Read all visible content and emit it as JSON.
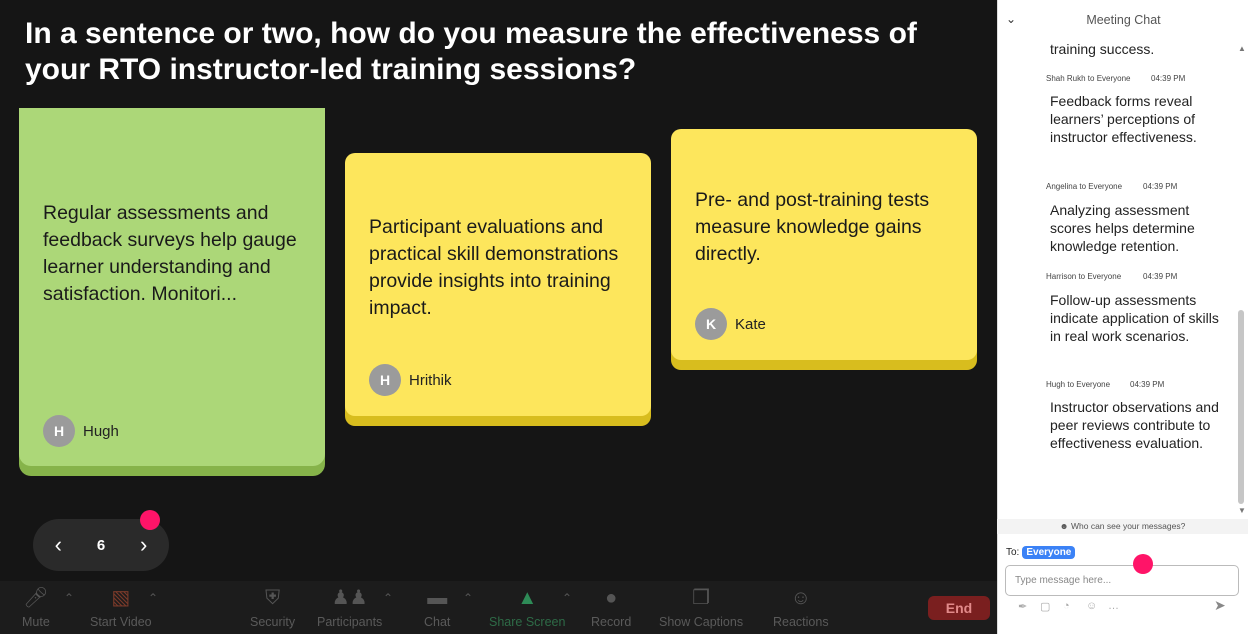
{
  "question": "In a sentence or two, how do you measure the effectiveness of your RTO instructor-led training sessions?",
  "notes": [
    {
      "text": "Regular assessments and feedback surveys help gauge learner understanding and satisfaction. Monitori...",
      "initial": "H",
      "author": "Hugh",
      "color": "#acd778"
    },
    {
      "text": "Participant evaluations and practical skill demonstrations provide insights into training impact.",
      "initial": "H",
      "author": "Hrithik",
      "color": "#fde65c"
    },
    {
      "text": "Pre- and post-training tests measure knowledge gains directly.",
      "initial": "K",
      "author": "Kate",
      "color": "#fde65c"
    }
  ],
  "pager": {
    "page": "6",
    "prev_icon": "chevron-left-icon",
    "next_icon": "chevron-right-icon"
  },
  "toolbar": {
    "mute": "Mute",
    "start_video": "Start Video",
    "security": "Security",
    "participants": "Participants",
    "chat": "Chat",
    "share_screen": "Share Screen",
    "record": "Record",
    "show_captions": "Show Captions",
    "reactions": "Reactions",
    "end": "End"
  },
  "chat": {
    "title": "Meeting Chat",
    "partial_text": "training success.",
    "messages": [
      {
        "from": "Shah Rukh to Everyone",
        "time": "04:39 PM",
        "text": "Feedback forms reveal learners’ perceptions of instructor effectiveness."
      },
      {
        "from": "Angelina to Everyone",
        "time": "04:39 PM",
        "text": "Analyzing assessment scores helps determine knowledge retention."
      },
      {
        "from": "Harrison to Everyone",
        "time": "04:39 PM",
        "text": "Follow-up assessments indicate application of skills in real work scenarios."
      },
      {
        "from": "Hugh to Everyone",
        "time": "04:39 PM",
        "text": "Instructor observations and peer reviews contribute to effectiveness evaluation."
      }
    ],
    "who_can_see": "Who can see your messages?",
    "to_label": "To:",
    "to_value": "Everyone",
    "input_placeholder": "Type message here..."
  },
  "colors": {
    "accent_dot": "#ff1468",
    "badge": "#3b82f6",
    "share_screen": "#2e8b57",
    "end": "#7a1f1f"
  }
}
